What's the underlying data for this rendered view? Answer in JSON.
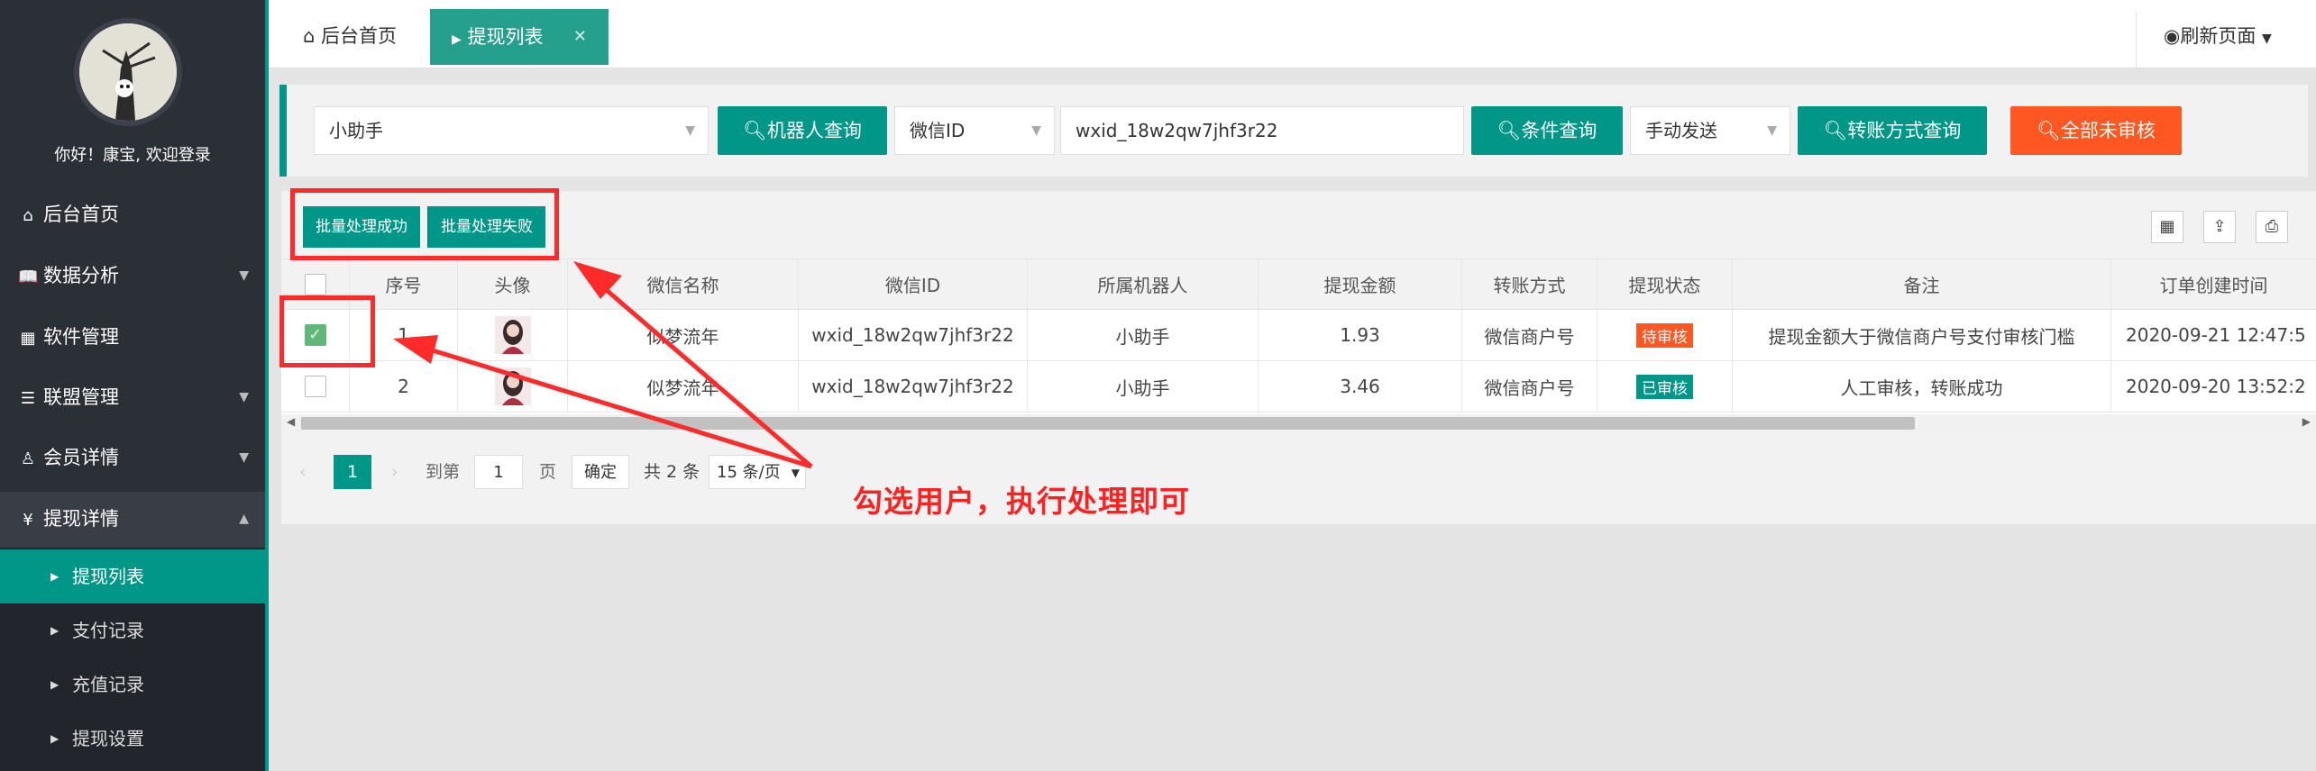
{
  "sidebar": {
    "welcome": "你好！康宝, 欢迎登录",
    "items": [
      {
        "label": "后台首页",
        "icon": "home-icon"
      },
      {
        "label": "数据分析",
        "icon": "book-icon"
      },
      {
        "label": "软件管理",
        "icon": "grid-icon"
      },
      {
        "label": "联盟管理",
        "icon": "list-icon"
      },
      {
        "label": "会员详情",
        "icon": "user-icon"
      },
      {
        "label": "提现详情",
        "icon": "yen-icon"
      }
    ],
    "subitems": [
      {
        "label": "提现列表",
        "active": true
      },
      {
        "label": "支付记录"
      },
      {
        "label": "充值记录"
      },
      {
        "label": "提现设置"
      }
    ]
  },
  "topbar": {
    "home_tab": "后台首页",
    "active_tab": "提现列表",
    "refresh": "刷新页面"
  },
  "search": {
    "robot_select": "小助手",
    "robot_query_button": "机器人查询",
    "field_select": "微信ID",
    "keyword_value": "wxid_18w2qw7jhf3r22",
    "condition_query_button": "条件查询",
    "method_select": "手动发送",
    "transfer_query_button": "转账方式查询",
    "all_unreviewed_button": "全部未审核"
  },
  "toolbar": {
    "batch_success": "批量处理成功",
    "batch_fail": "批量处理失败"
  },
  "table": {
    "headers": [
      "序号",
      "头像",
      "微信名称",
      "微信ID",
      "所属机器人",
      "提现金额",
      "转账方式",
      "提现状态",
      "备注",
      "订单创建时间"
    ],
    "rows": [
      {
        "checked": true,
        "no": "1",
        "name": "似梦流年",
        "wxid": "wxid_18w2qw7jhf3r22",
        "robot": "小助手",
        "amount": "1.93",
        "method": "微信商户号",
        "status": "待审核",
        "status_color": "#ff5722",
        "remark": "提现金额大于微信商户号支付审核门槛",
        "time": "2020-09-21 12:47:5"
      },
      {
        "checked": false,
        "no": "2",
        "name": "似梦流年",
        "wxid": "wxid_18w2qw7jhf3r22",
        "robot": "小助手",
        "amount": "3.46",
        "method": "微信商户号",
        "status": "已审核",
        "status_color": "#009688",
        "remark": "人工审核，转账成功",
        "time": "2020-09-20 13:52:2"
      }
    ]
  },
  "pager": {
    "current": "1",
    "goto_label": "到第",
    "goto_value": "1",
    "page_label": "页",
    "confirm": "确定",
    "total": "共 2 条",
    "per_page": "15 条/页"
  },
  "annotation": {
    "text": "勾选用户，执行处理即可"
  },
  "colors": {
    "accent": "#009688",
    "danger": "#ff5722",
    "sidebar": "#2b2f36",
    "annotation": "#ff2a2a"
  }
}
